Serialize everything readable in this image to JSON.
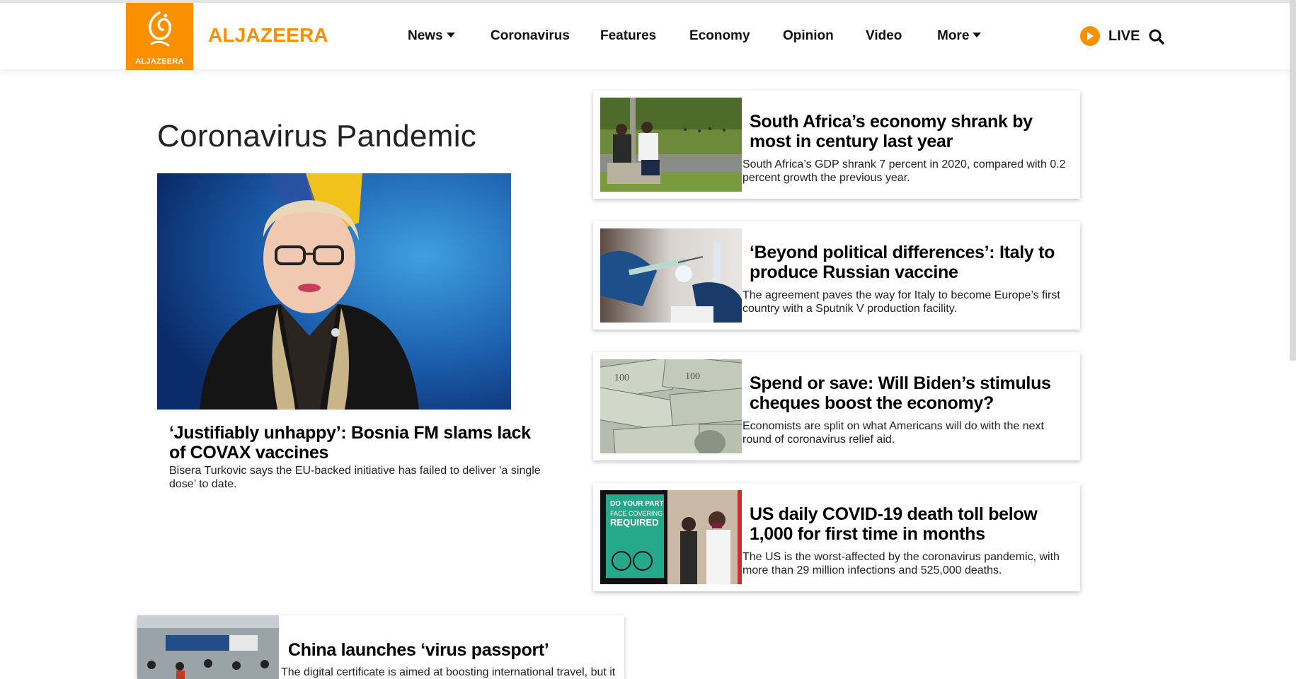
{
  "header": {
    "brand": "ALJAZEERA",
    "logo_text": "ALJAZEERA",
    "nav": [
      {
        "label": "News",
        "dropdown": true
      },
      {
        "label": "Coronavirus",
        "dropdown": false
      },
      {
        "label": "Features",
        "dropdown": false
      },
      {
        "label": "Economy",
        "dropdown": false
      },
      {
        "label": "Opinion",
        "dropdown": false
      },
      {
        "label": "Video",
        "dropdown": false
      },
      {
        "label": "More",
        "dropdown": true
      }
    ],
    "live_label": "LIVE",
    "colors": {
      "brand": "#fa9000",
      "text": "#111111"
    }
  },
  "section": {
    "title": "Coronavirus Pandemic"
  },
  "feature": {
    "headline": "‘Justifiably unhappy’: Bosnia FM slams lack of COVAX vaccines",
    "summary": "Bisera Turkovic says the EU-backed initiative has failed to deliver ‘a single dose’ to date."
  },
  "cards": [
    {
      "title": "South Africa’s economy shrank by most in century last year",
      "summary": "South Africa’s GDP shrank 7 percent in 2020, compared with 0.2 percent growth the previous year."
    },
    {
      "title": "‘Beyond political differences’: Italy to produce Russian vaccine",
      "summary": "The agreement paves the way for Italy to become Europe’s first country with a Sputnik V production facility."
    },
    {
      "title": "Spend or save: Will Biden’s stimulus cheques boost the economy?",
      "summary": "Economists are split on what Americans will do with the next round of coronavirus relief aid."
    },
    {
      "title": "US daily COVID-19 death toll below 1,000 for first time in months",
      "summary": "The US is the worst-affected by the coronavirus pandemic, with more than 29 million infections and 525,000 deaths."
    }
  ],
  "bottom_card": {
    "title": "China launches ‘virus passport’",
    "summary": "The digital certificate is aimed at boosting international travel, but it"
  },
  "photo_signs": {
    "covid_sign": [
      "DO YOUR PART",
      "FACE COVERING",
      "REQUIRED"
    ]
  }
}
